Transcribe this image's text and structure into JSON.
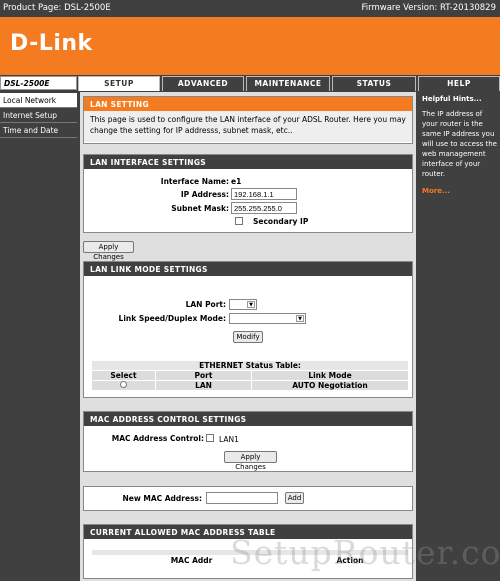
{
  "topbar": {
    "product": "Product Page: DSL-2500E",
    "firmware": "Firmware Version: RT-20130829"
  },
  "brand": {
    "logo": "D-Link"
  },
  "model": "DSL-2500E",
  "tabs": [
    {
      "label": "SETUP",
      "active": true
    },
    {
      "label": "ADVANCED"
    },
    {
      "label": "MAINTENANCE"
    },
    {
      "label": "STATUS"
    },
    {
      "label": "HELP"
    }
  ],
  "sidebar": {
    "items": [
      {
        "label": "Local Network"
      },
      {
        "label": "Internet Setup"
      },
      {
        "label": "Time and Date"
      }
    ]
  },
  "hints": {
    "title": "Helpful Hints...",
    "text": "The IP address of your router is the same IP address you will use to access the web management interface of your router.",
    "more": "More..."
  },
  "lan_setting": {
    "title": "LAN SETTING",
    "description": "This page is used to configure the LAN interface of your ADSL Router. Here you may change the setting for IP addresss, subnet mask, etc.."
  },
  "lan_interface": {
    "title": "LAN INTERFACE SETTINGS",
    "interface_label": "Interface Name:",
    "interface_value": "e1",
    "ip_label": "IP Address:",
    "ip_value": "192.168.1.1",
    "mask_label": "Subnet Mask:",
    "mask_value": "255.255.255.0",
    "secondary_label": "Secondary IP",
    "apply": "Apply Changes"
  },
  "lan_link": {
    "title": "LAN LINK MODE SETTINGS",
    "port_label": "LAN Port:",
    "speed_label": "Link Speed/Duplex Mode:",
    "modify": "Modify",
    "table_title": "ETHERNET Status Table:",
    "headers": [
      "Select",
      "Port",
      "Link Mode"
    ],
    "rows": [
      {
        "port": "LAN",
        "mode": "AUTO Negotiation"
      }
    ]
  },
  "mac_control": {
    "title": "MAC ADDRESS CONTROL SETTINGS",
    "label": "MAC Address Control:",
    "option": "LAN1",
    "apply": "Apply Changes"
  },
  "new_mac": {
    "label": "New MAC Address:",
    "add": "Add"
  },
  "allowed_table": {
    "title": "CURRENT ALLOWED MAC ADDRESS TABLE",
    "headers": [
      "MAC Addr",
      "Action"
    ]
  },
  "watermark": "SetupRouter.com",
  "colors": {
    "accent": "#f47b20",
    "dark": "#404040"
  }
}
